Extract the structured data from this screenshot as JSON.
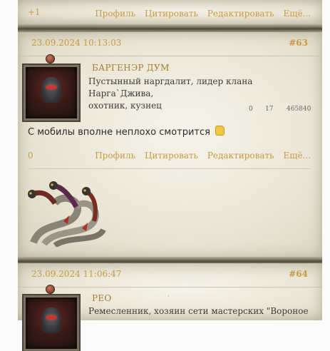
{
  "actions": [
    "Профиль",
    "Цитировать",
    "Редактировать",
    "Ещё..."
  ],
  "post_prev": {
    "rating": "+1"
  },
  "post63": {
    "date": "23.09.2024 10:13:03",
    "number": "#63",
    "user": "БАРГЕНЭР ДУМ",
    "title_line1": "Пустынный наргдалит, лидер клана Нарга`Джива,",
    "title_line2": "охотник, кузнец",
    "stats": [
      "0",
      "17",
      "465840"
    ],
    "message": "С мобилы вполне неплохо смотрится",
    "rating": "0"
  },
  "post64": {
    "date": "23.09.2024 11:06:47",
    "number": "#64",
    "user": "РЕО",
    "title_line1": "Ремесленник, хозяин сети мастерских \"Вороное"
  },
  "colors": {
    "link": "#c79a3f",
    "text": "#2b2b2b",
    "panel": "#ebe6d7"
  }
}
